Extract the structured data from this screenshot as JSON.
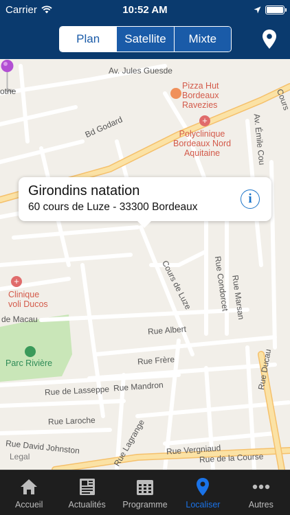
{
  "status_bar": {
    "carrier": "Carrier",
    "time": "10:52 AM"
  },
  "nav": {
    "segments": [
      {
        "label": "Plan",
        "active": true
      },
      {
        "label": "Satellite",
        "active": false
      },
      {
        "label": "Mixte",
        "active": false
      }
    ],
    "right_icon": "location-pin-icon"
  },
  "map": {
    "street_labels": [
      "Av. Jules Guesde",
      "Bd Godard",
      "Cours de Luze",
      "Rue Albert",
      "Rue Frère",
      "Rue Mandron",
      "Rue de Lasseppe",
      "Rue Laroche",
      "Rue David Johnston",
      "Rue Lagrange",
      "Rue Vergniaud",
      "Rue de la Course",
      "Rue Condorcet",
      "Rue Marsan",
      "Rue Ducau",
      "Av. Émile Cou",
      "Cours",
      "de Macau",
      "othe",
      "Legal"
    ],
    "poi_labels": {
      "pizza": "Pizza Hut\nBordeaux\nRavezies",
      "polyclinique": "Polyclinique\nBordeaux Nord\nAquitaine",
      "clinique": "Clinique\nvoli Ducos",
      "park": "Parc Rivière"
    }
  },
  "callout": {
    "title": "Girondins natation",
    "address": "60 cours de Luze - 33300 Bordeaux",
    "info_symbol": "i"
  },
  "tabs": [
    {
      "label": "Accueil",
      "icon": "home-icon",
      "active": false
    },
    {
      "label": "Actualités",
      "icon": "newspaper-icon",
      "active": false
    },
    {
      "label": "Programme",
      "icon": "calendar-icon",
      "active": false
    },
    {
      "label": "Localiser",
      "icon": "location-pin-icon",
      "active": true
    },
    {
      "label": "Autres",
      "icon": "more-icon",
      "active": false
    }
  ],
  "colors": {
    "nav_bg": "#0a3a6e",
    "segment_blue": "#1a5ba8",
    "tab_active": "#1a73e8",
    "pin": "#b24fd3"
  }
}
